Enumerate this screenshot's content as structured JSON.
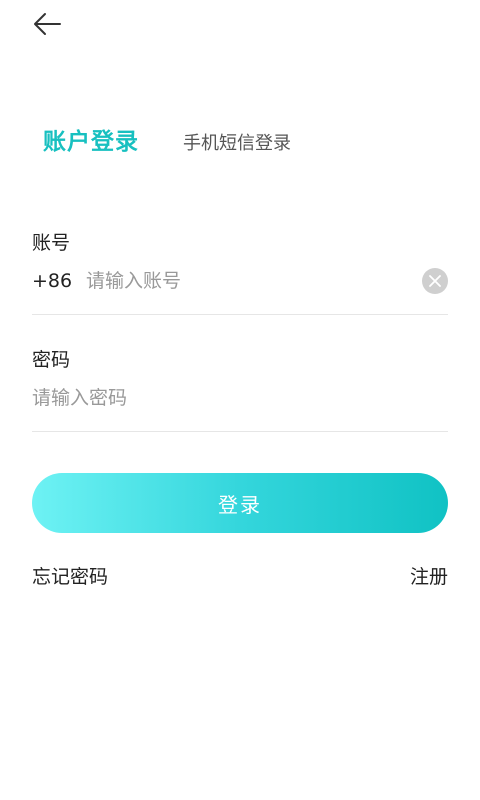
{
  "header": {
    "back_icon": "arrow-left-icon"
  },
  "tabs": [
    {
      "label": "账户登录",
      "active": true
    },
    {
      "label": "手机短信登录",
      "active": false
    }
  ],
  "account": {
    "label": "账号",
    "prefix": "+86",
    "placeholder": "请输入账号",
    "value": "",
    "clear_icon": "clear-icon"
  },
  "password": {
    "label": "密码",
    "placeholder": "请输入密码",
    "value": ""
  },
  "login_button": {
    "label": "登录"
  },
  "links": {
    "forgot": "忘记密码",
    "register": "注册"
  },
  "colors": {
    "accent": "#18c0c0",
    "button_gradient_start": "#6ef2f4",
    "button_gradient_end": "#10c2c4"
  }
}
